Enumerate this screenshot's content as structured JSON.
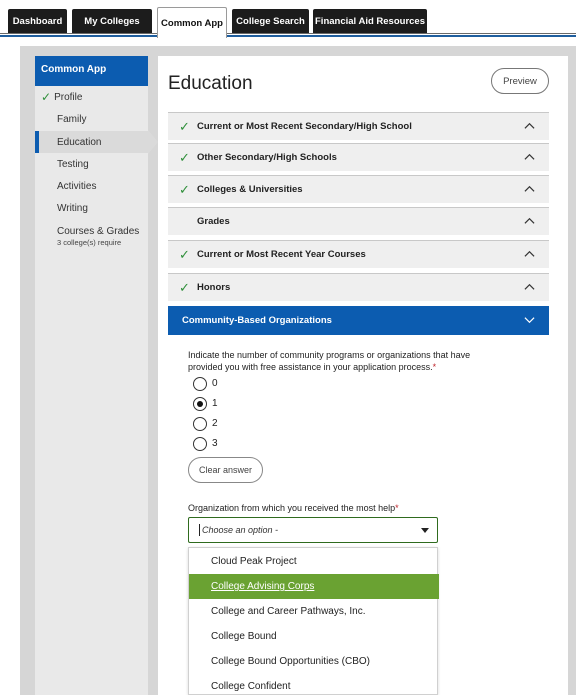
{
  "tabs": [
    {
      "label": "Dashboard",
      "active": false
    },
    {
      "label": "My Colleges",
      "active": false
    },
    {
      "label": "Common App",
      "active": true
    },
    {
      "label": "College Search",
      "active": false
    },
    {
      "label": "Financial Aid Resources",
      "active": false
    }
  ],
  "sidebar": {
    "header": "Common App",
    "items": [
      {
        "label": "Profile",
        "complete": true
      },
      {
        "label": "Family",
        "complete": false
      },
      {
        "label": "Education",
        "complete": false,
        "active": true
      },
      {
        "label": "Testing",
        "complete": false
      },
      {
        "label": "Activities",
        "complete": false
      },
      {
        "label": "Writing",
        "complete": false
      },
      {
        "label": "Courses & Grades",
        "sub": "3 college(s) require",
        "complete": false
      }
    ]
  },
  "page": {
    "title": "Education",
    "preview_label": "Preview"
  },
  "sections": [
    {
      "label": "Current or Most Recent Secondary/High School",
      "complete": true
    },
    {
      "label": "Other Secondary/High Schools",
      "complete": true
    },
    {
      "label": "Colleges & Universities",
      "complete": true
    },
    {
      "label": "Grades",
      "complete": false
    },
    {
      "label": "Current or Most Recent Year Courses",
      "complete": true
    },
    {
      "label": "Honors",
      "complete": true
    },
    {
      "label": "Community-Based Organizations",
      "complete": false,
      "expanded": true
    }
  ],
  "question1": {
    "text": "Indicate the number of community programs or organizations that have provided you with free assistance in your application process.",
    "required_mark": "*",
    "options": [
      "0",
      "1",
      "2",
      "3"
    ],
    "selected": "1",
    "clear_label": "Clear answer"
  },
  "question2": {
    "text": "Organization from which you received the most help",
    "required_mark": "*",
    "placeholder": "Choose an option -",
    "options": [
      "Cloud Peak Project",
      "College Advising Corps",
      "College and Career Pathways, Inc.",
      "College Bound",
      "College Bound Opportunities (CBO)",
      "College Confident"
    ],
    "highlighted": "College Advising Corps"
  },
  "colors": {
    "brand_blue": "#0c5cb0",
    "check_green": "#2f8f3a",
    "highlight_green": "#6aa232",
    "required_red": "#c0262d"
  }
}
